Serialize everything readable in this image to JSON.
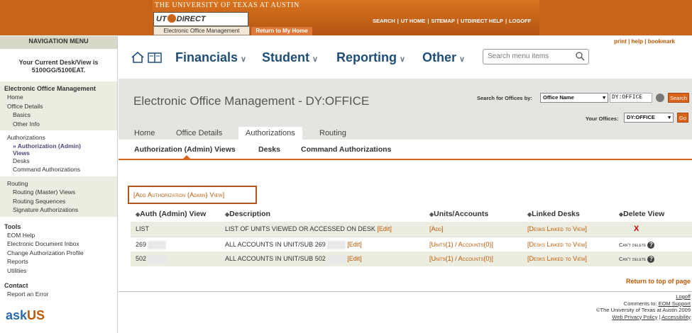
{
  "banner": {
    "university": "THE UNIVERSITY OF TEXAS AT AUSTIN",
    "logo_left": "UT",
    "logo_right": "DIRECT",
    "eom_tab": "Electronic Office Management",
    "home_tab": "Return to My Home",
    "top_links": [
      "SEARCH",
      "UT HOME",
      "SITEMAP",
      "UTDIRECT HELP",
      "LOGOFF"
    ]
  },
  "nav": {
    "header": "NAVIGATION MENU",
    "desk_line1": "Your Current Desk/View is",
    "desk_line2": "5100GG/5100EAT.",
    "eom_title": "Electronic Office Management",
    "home": "Home",
    "office_details": "Office Details",
    "basics": "Basics",
    "other_info": "Other Info",
    "authorizations": "Authorizations",
    "auth_current_1": "» Authorization (Admin)",
    "auth_current_2": "Views",
    "desks": "Desks",
    "command_auth": "Command Authorizations",
    "routing": "Routing",
    "routing_master": "Routing (Master) Views",
    "routing_seq": "Routing Sequences",
    "signature_auth": "Signature Authorizations",
    "tools": "Tools",
    "eom_help": "EOM Help",
    "doc_inbox": "Electronic Document Inbox",
    "change_profile": "Change Authorization Profile",
    "reports": "Reports",
    "utilities": "Utilities",
    "contact": "Contact",
    "report_error": "Report an Error",
    "ask_logo": "ask",
    "ask_logo_u": "US"
  },
  "menubar": {
    "print": "print",
    "help": "help",
    "bookmark": "bookmark",
    "items": [
      "Financials",
      "Student",
      "Reporting",
      "Other"
    ],
    "chevron": "∨",
    "search_placeholder": "Search menu items"
  },
  "header": {
    "title": "Electronic Office Management - DY:OFFICE",
    "search_for_label": "Search for Offices by:",
    "search_by_value": "Office Name",
    "search_input_value": "DY:OFFICE",
    "search_button": "Search",
    "your_offices_label": "Your Offices:",
    "your_offices_value": "DY:OFFICE",
    "go_button": "Go",
    "tabs": [
      "Home",
      "Office Details",
      "Authorizations",
      "Routing"
    ]
  },
  "subtabs": [
    "Authorization (Admin) Views",
    "Desks",
    "Command Authorizations"
  ],
  "content": {
    "add_link": "[Add Authorization (Admin) View]",
    "columns": [
      "Auth (Admin) View",
      "Description",
      "Units/Accounts",
      "Linked Desks",
      "Delete View"
    ],
    "sort_glyph": "◆",
    "rows": [
      {
        "view": "LIST",
        "description": "LIST OF UNITS VIEWED OR ACCESSED ON DESK",
        "desc_link": "[Edit]",
        "units": "[Add]",
        "desks": "[Desks Linked to View]",
        "delete": "X"
      },
      {
        "view": "269",
        "description": "ALL ACCOUNTS IN UNIT/SUB 269",
        "desc_link": "[Edit]",
        "units": "[Units(1) / Accounts(0)]",
        "desks": "[Desks Linked to View]",
        "delete": "Can't delete"
      },
      {
        "view": "502",
        "description": "ALL ACCOUNTS IN UNIT/SUB 502",
        "desc_link": "[Edit]",
        "units": "[Units(1) / Accounts(0)]",
        "desks": "[Desks Linked to View]",
        "delete": "Can't delete"
      }
    ],
    "help_glyph": "?",
    "return_top": "Return to top of page",
    "footer_logoff": "Logoff",
    "footer_comments": "Comments to:",
    "footer_support": "EOM Support",
    "footer_copyright": "©The University of Texas at Austin 2009",
    "footer_privacy": "Web Privacy Policy",
    "footer_access": "Accessibility"
  },
  "colors": {
    "burnt_orange": "#bf5700",
    "banner": "#c8641a",
    "navy": "#1f4e79"
  }
}
